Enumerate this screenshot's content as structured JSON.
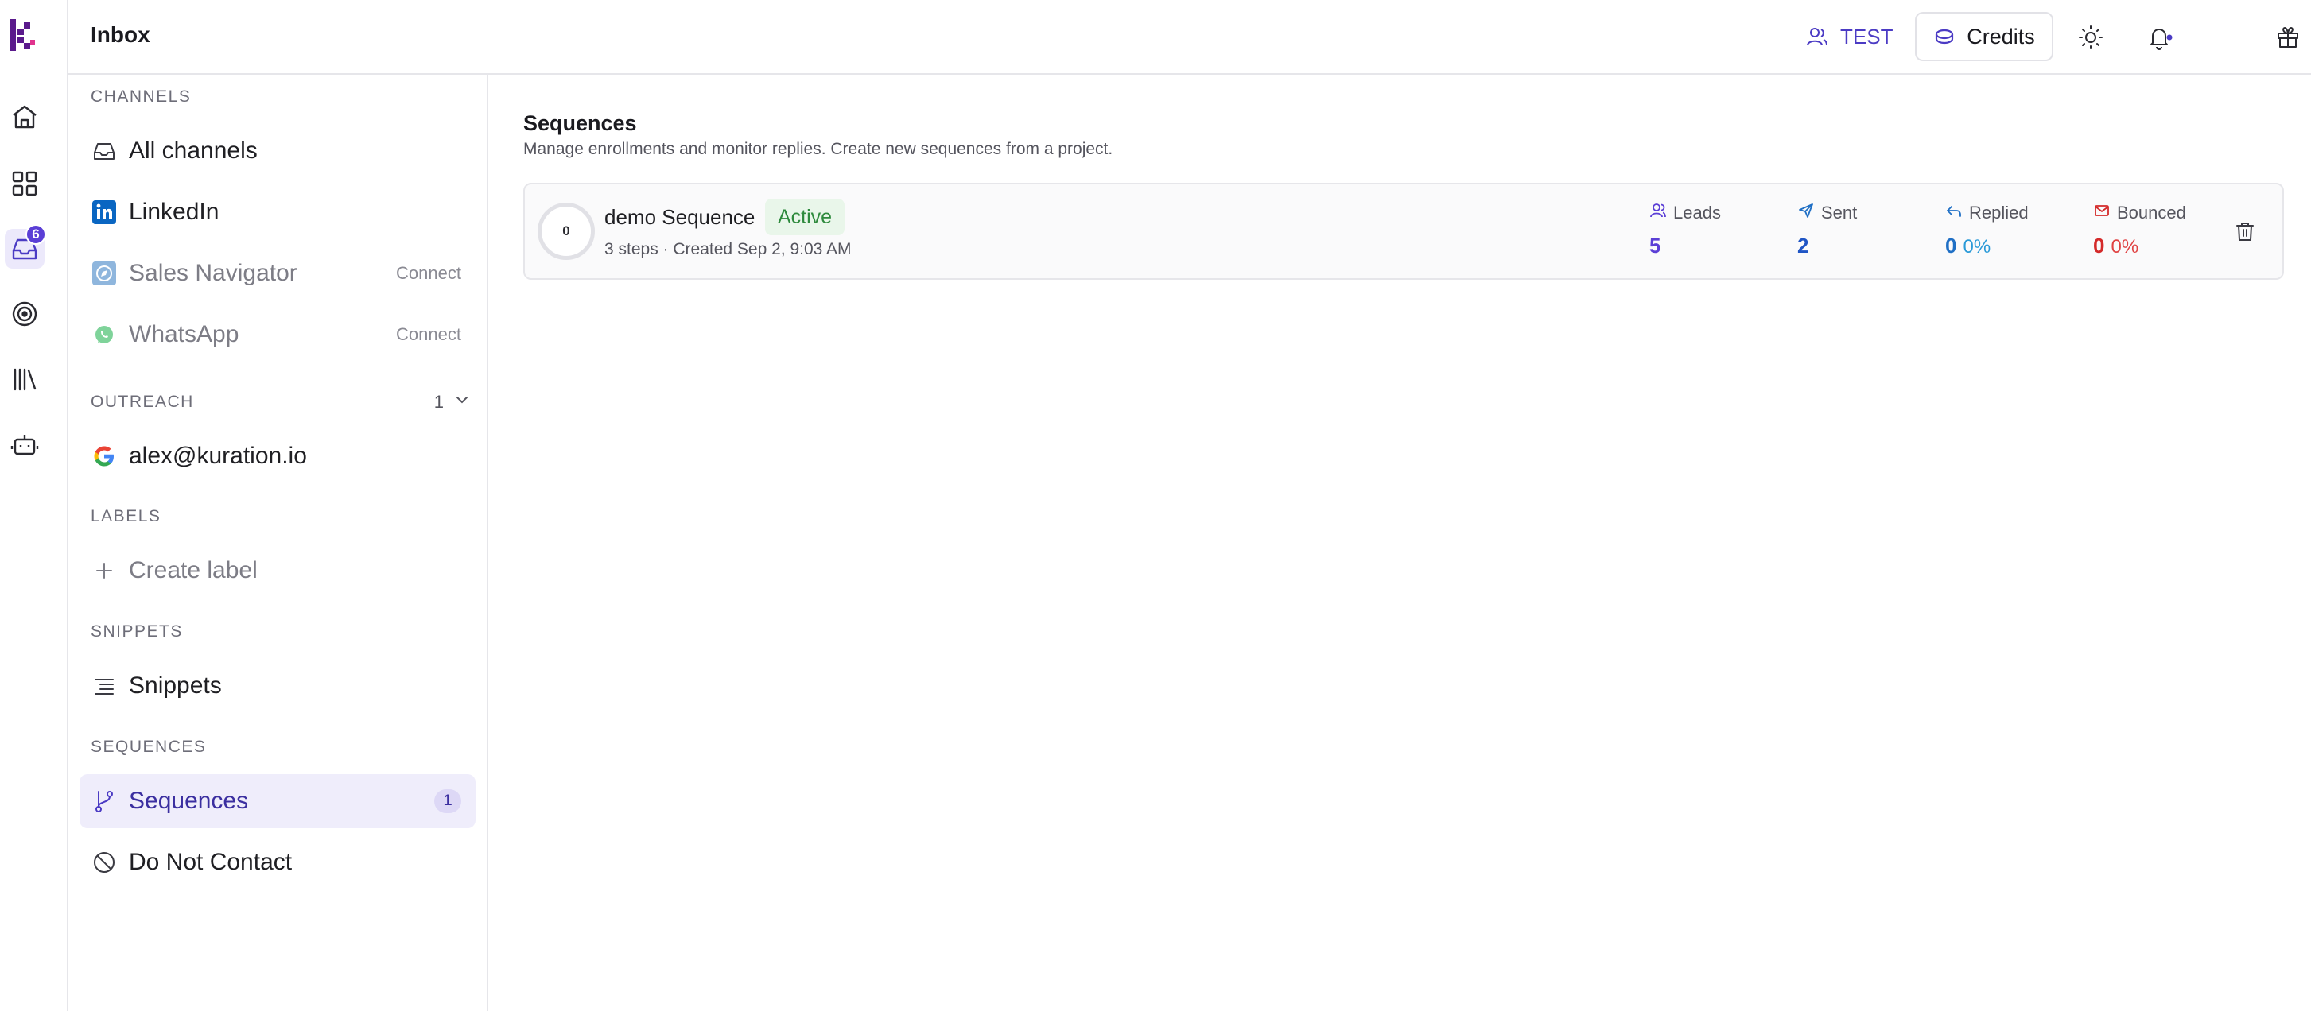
{
  "header": {
    "title": "Inbox",
    "team_label": "TEST",
    "credits_label": "Credits"
  },
  "rail": {
    "inbox_badge": "6"
  },
  "sidebar": {
    "channels_label": "CHANNELS",
    "channels": [
      {
        "label": "All channels"
      },
      {
        "label": "LinkedIn"
      },
      {
        "label": "Sales Navigator",
        "action": "Connect"
      },
      {
        "label": "WhatsApp",
        "action": "Connect"
      }
    ],
    "outreach_label": "OUTREACH",
    "outreach_count": "1",
    "outreach_accounts": [
      {
        "label": "alex@kuration.io"
      }
    ],
    "labels_label": "LABELS",
    "create_label": "Create label",
    "snippets_label": "SNIPPETS",
    "snippets_item": "Snippets",
    "sequences_label": "SEQUENCES",
    "sequences_item": "Sequences",
    "sequences_count": "1",
    "dnc_item": "Do Not Contact"
  },
  "main": {
    "title": "Sequences",
    "subtitle": "Manage enrollments and monitor replies. Create new sequences from a project.",
    "sequences": [
      {
        "progress": "0",
        "name": "demo Sequence",
        "status": "Active",
        "meta": "3 steps · Created Sep 2, 9:03 AM",
        "stats": {
          "leads_label": "Leads",
          "leads": "5",
          "sent_label": "Sent",
          "sent": "2",
          "replied_label": "Replied",
          "replied": "0",
          "replied_pct": "0%",
          "bounced_label": "Bounced",
          "bounced": "0",
          "bounced_pct": "0%"
        }
      }
    ]
  },
  "colors": {
    "accent": "#5b3fd6",
    "active_green": "#2e8a3d",
    "replied_blue": "#1f6fc5",
    "bounced_red": "#d42a2a"
  }
}
